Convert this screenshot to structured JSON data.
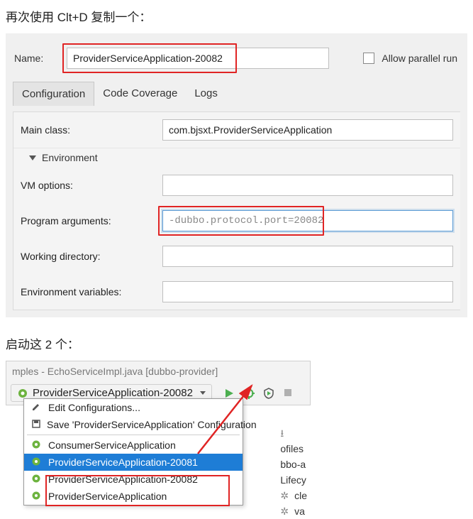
{
  "doc": {
    "intro1": "再次使用 Clt+D  复制一个：",
    "intro2": "启动这 2 个："
  },
  "config": {
    "name_label": "Name:",
    "name_value": "ProviderServiceApplication-20082",
    "allow_parallel_label": "Allow parallel run",
    "tabs": {
      "configuration": "Configuration",
      "code_coverage": "Code Coverage",
      "logs": "Logs"
    },
    "fields": {
      "main_class_label": "Main class:",
      "main_class_value": "com.bjsxt.ProviderServiceApplication",
      "environment_header": "Environment",
      "vm_options_label": "VM options:",
      "vm_options_value": "",
      "program_arguments_label": "Program arguments:",
      "program_arguments_value": "-dubbo.protocol.port=20082",
      "working_directory_label": "Working directory:",
      "working_directory_value": "",
      "env_vars_label": "Environment variables:",
      "env_vars_value": ""
    }
  },
  "shot2": {
    "title_fragment": "mples - EchoServiceImpl.java [dubbo-provider]",
    "combo_label": "ProviderServiceApplication-20082",
    "dropdown": {
      "edit": "Edit Configurations...",
      "save": "Save 'ProviderServiceApplication' Configuration",
      "item_consumer": "ConsumerServiceApplication",
      "item_p81": "ProviderServiceApplication-20081",
      "item_p82": "ProviderServiceApplication-20082",
      "item_p": "ProviderServiceApplication"
    },
    "tree": {
      "download_glyph": "⭳",
      "profiles": "ofiles",
      "bboa": "bbo-a",
      "lifecy": "Lifecy",
      "cle": "cle",
      "va": "va"
    }
  }
}
